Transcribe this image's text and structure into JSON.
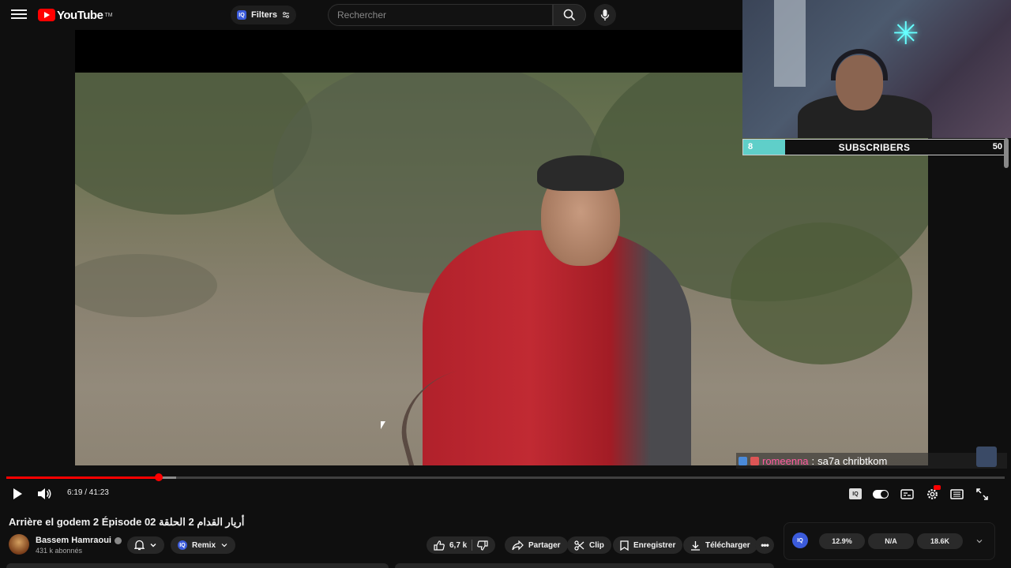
{
  "header": {
    "logo_text": "YouTube",
    "logo_tm": "TM",
    "filters_label": "Filters",
    "filters_badge": "IQ",
    "search_placeholder": "Rechercher"
  },
  "webcam": {
    "subscriber_goal": {
      "current": "8",
      "label": "SUBSCRIBERS",
      "goal": "50",
      "fill_fraction": 0.16
    }
  },
  "chat": {
    "username": "romeenna",
    "separator": ":",
    "message": "sa7a chribtkom"
  },
  "player": {
    "current_time": "6:19",
    "duration": "41:23",
    "time_display": "6:19 / 41:23",
    "progress_fraction": 0.1527,
    "buffer_fraction": 0.17
  },
  "video": {
    "title": "Arrière el godem 2 Épisode 02 أريار القدام 2 الحلقة",
    "channel_name": "Bassem Hamraoui",
    "subscriber_count": "431 k abonnés"
  },
  "actions": {
    "remix_label": "Remix",
    "remix_badge": "IQ",
    "like_count": "6,7 k",
    "share_label": "Partager",
    "clip_label": "Clip",
    "save_label": "Enregistrer",
    "download_label": "Télécharger"
  },
  "stats": {
    "badge": "IQ",
    "stat1": "12.9%",
    "stat2": "N/A",
    "stat3": "18.6K"
  },
  "colors": {
    "accent_red": "#ff0000",
    "iq_blue": "#3b5bdb",
    "chat_username": "#ff5aa0",
    "sub_fill": "#5fcfc9"
  }
}
